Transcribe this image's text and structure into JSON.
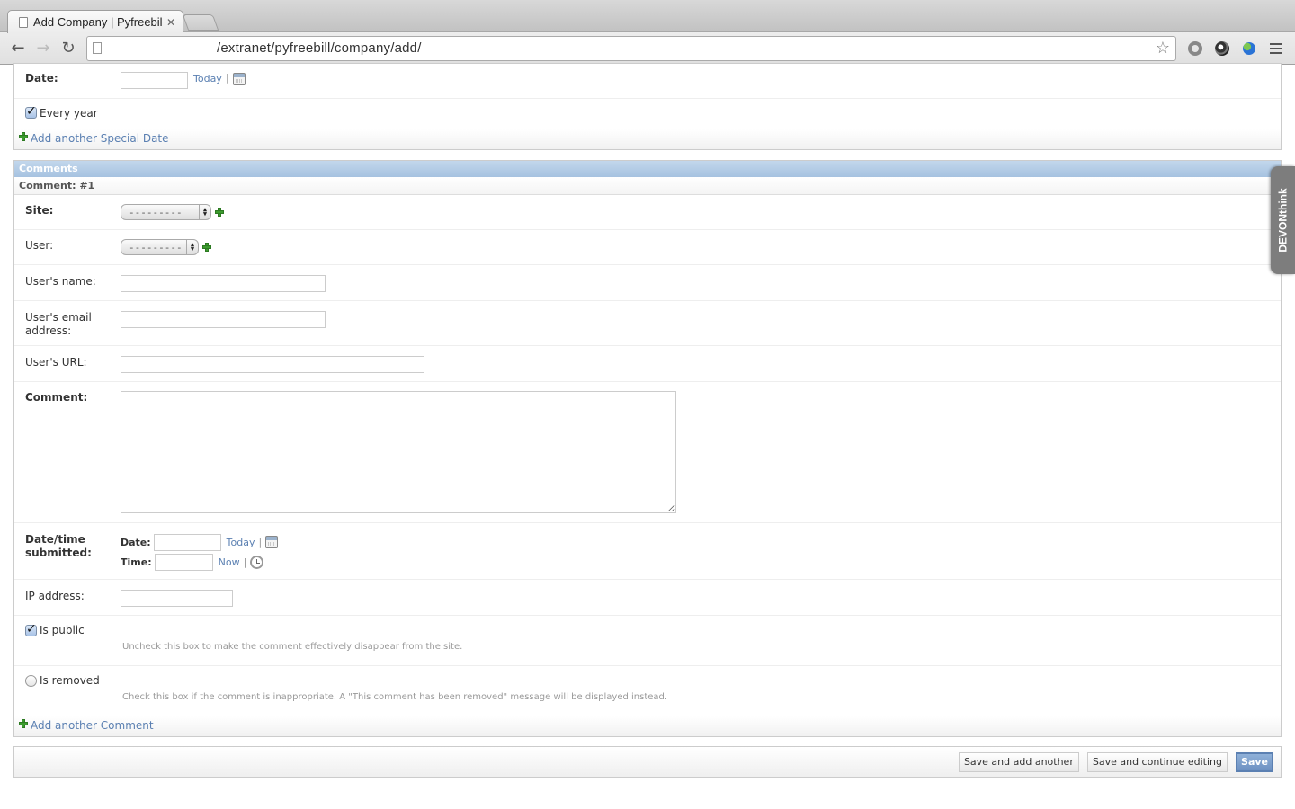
{
  "browser": {
    "tab_title": "Add Company | Pyfreebillin",
    "url": "/extranet/pyfreebill/company/add/",
    "icons": [
      "back-arrow-icon",
      "forward-arrow-icon",
      "reload-icon",
      "page-icon",
      "bookmark-star-icon",
      "extension-circle-icon",
      "extension-snail-icon",
      "extension-globe-icon",
      "menu-icon"
    ]
  },
  "special_dates": {
    "date_label": "Date:",
    "date_value": "",
    "today_link": "Today",
    "separator": "|",
    "every_year_label": "Every year",
    "every_year_checked": true,
    "add_another": "Add another Special Date"
  },
  "comments": {
    "section_title": "Comments",
    "subheader": "Comment: #1",
    "site_label": "Site:",
    "site_value": "---------",
    "user_label": "User:",
    "user_value": "---------",
    "user_name_label": "User's name:",
    "user_name_value": "",
    "user_email_label": "User's email address:",
    "user_email_value": "",
    "user_url_label": "User's URL:",
    "user_url_value": "",
    "comment_label": "Comment:",
    "comment_value": "",
    "submitted_label": "Date/time submitted:",
    "date_sub_label": "Date:",
    "today_link": "Today",
    "time_sub_label": "Time:",
    "now_link": "Now",
    "separator": "|",
    "ip_label": "IP address:",
    "ip_value": "",
    "is_public_label": "Is public",
    "is_public_checked": true,
    "is_public_help": "Uncheck this box to make the comment effectively disappear from the site.",
    "is_removed_label": "Is removed",
    "is_removed_checked": false,
    "is_removed_help": "Check this box if the comment is inappropriate. A \"This comment has been removed\" message will be displayed instead.",
    "add_another": "Add another Comment"
  },
  "submit_row": {
    "save_add_another": "Save and add another",
    "save_continue": "Save and continue editing",
    "save": "Save"
  },
  "devonthink_tab": "DEVONthink",
  "colors": {
    "link": "#5b80b2",
    "header_blue": "#a6c2e0",
    "plus_green": "#3c9b2e"
  }
}
